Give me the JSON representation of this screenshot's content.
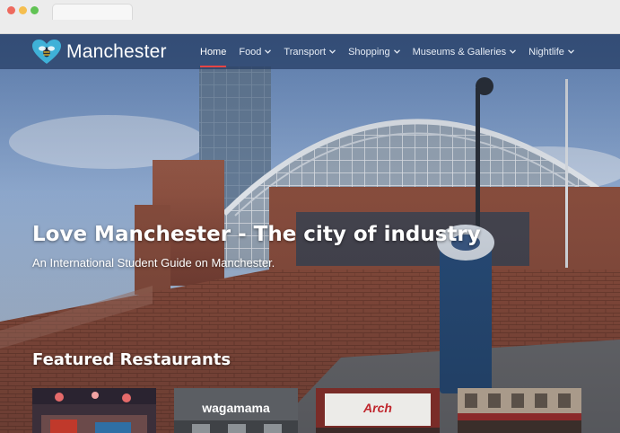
{
  "site": {
    "brand": "Manchester"
  },
  "nav": [
    {
      "label": "Home",
      "active": true,
      "dropdown": false
    },
    {
      "label": "Food",
      "active": false,
      "dropdown": true
    },
    {
      "label": "Transport",
      "active": false,
      "dropdown": true
    },
    {
      "label": "Shopping",
      "active": false,
      "dropdown": true
    },
    {
      "label": "Museums & Galleries",
      "active": false,
      "dropdown": true
    },
    {
      "label": "Nightlife",
      "active": false,
      "dropdown": true
    }
  ],
  "hero": {
    "title": "Love Manchester - The city of industry",
    "subtitle": "An International Student Guide on Manchester."
  },
  "featured": {
    "heading": "Featured Restaurants",
    "cards": [
      {
        "label": ""
      },
      {
        "label": "wagamama"
      },
      {
        "label": "Arch"
      },
      {
        "label": ""
      }
    ]
  },
  "colors": {
    "navbar": "#243c62",
    "accent": "#e64545",
    "logo_heart": "#3fb1d8"
  },
  "icons": {
    "logo": "heart-bee-icon",
    "dropdown": "chevron-down-icon"
  }
}
